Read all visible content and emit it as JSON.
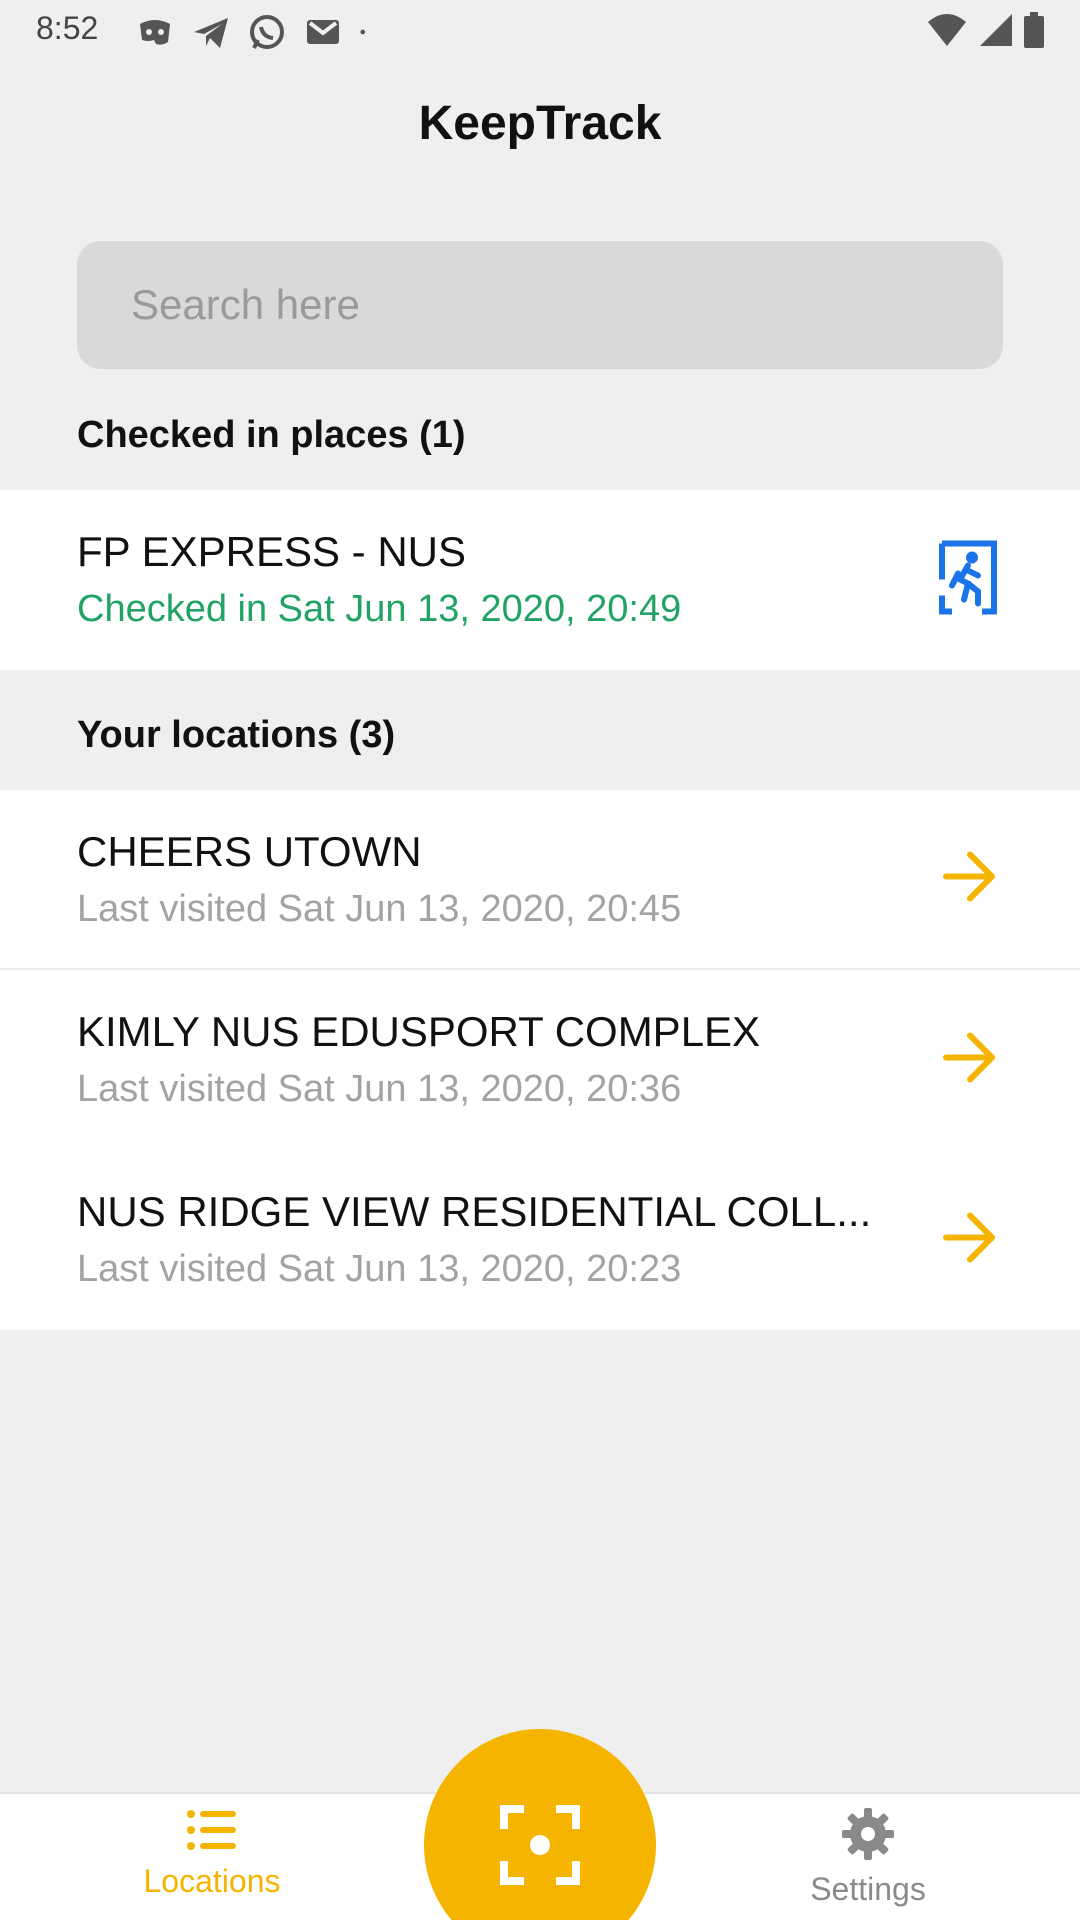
{
  "status_bar": {
    "time": "8:52",
    "left_icons": [
      "discord-icon",
      "telegram-icon",
      "whatsapp-icon",
      "gmail-icon",
      "dot-icon"
    ],
    "right_icons": [
      "wifi-icon",
      "signal-icon",
      "battery-icon"
    ]
  },
  "header": {
    "title": "KeepTrack"
  },
  "search": {
    "placeholder": "Search here",
    "value": ""
  },
  "checked_in": {
    "section_title": "Checked in places (1)",
    "items": [
      {
        "name": "FP EXPRESS - NUS",
        "status": "Checked in Sat Jun 13, 2020, 20:49",
        "icon": "checkout-exit-icon"
      }
    ]
  },
  "locations": {
    "section_title": "Your locations (3)",
    "items": [
      {
        "name": "CHEERS UTOWN",
        "status": "Last visited Sat Jun 13, 2020, 20:45",
        "icon": "arrow-right-icon"
      },
      {
        "name": "KIMLY NUS EDUSPORT COMPLEX",
        "status": "Last visited Sat Jun 13, 2020, 20:36",
        "icon": "arrow-right-icon"
      },
      {
        "name": "NUS RIDGE VIEW RESIDENTIAL COLL...",
        "status": "Last visited Sat Jun 13, 2020, 20:23",
        "icon": "arrow-right-icon"
      }
    ]
  },
  "bottom_nav": {
    "locations_label": "Locations",
    "settings_label": "Settings",
    "scan_icon": "scan-qr-icon"
  },
  "colors": {
    "accent": "#f5b400",
    "checked_in_green": "#21a366",
    "exit_icon_blue": "#1a73e8",
    "background": "#efefef"
  }
}
